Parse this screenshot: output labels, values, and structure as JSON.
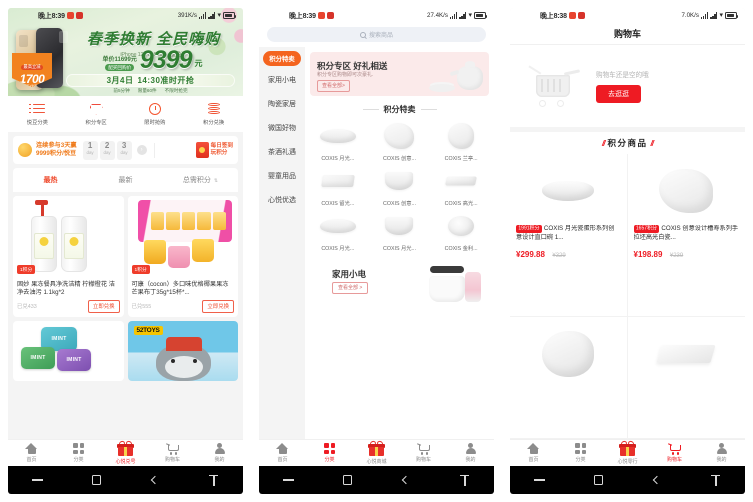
{
  "phone1": {
    "status": {
      "time": "晚上8:39",
      "speed": "391K/s",
      "icons": [
        "signal",
        "signal",
        "wifi",
        "battery"
      ]
    },
    "banner": {
      "title": "春季换新 全民嗨购",
      "subtitle": "iPhone 12 Pro 5199（金色）",
      "old_price_label": "单价11699元",
      "old_price_tag": "配买回购价",
      "price": "9399",
      "price_unit": "元",
      "date": "3月4日",
      "time": "14:30准时开抢",
      "sub1": "前5分钟",
      "sub2": "限量60件",
      "sub3": "不限时抢完",
      "flag_top": "最高立减",
      "flag_num": "1700",
      "flag_bottom": "元优惠"
    },
    "quicknav": [
      {
        "icon": "list-icon",
        "label": "悦豆分类"
      },
      {
        "icon": "diamond-icon",
        "label": "积分专区"
      },
      {
        "icon": "clock-icon",
        "label": "限时抢购"
      },
      {
        "icon": "coins-icon",
        "label": "积分兑换"
      }
    ],
    "signin": {
      "line1": "连续参与3天赢",
      "line2": "9999积分/悦豆",
      "days": [
        {
          "n": "1",
          "unit": "day"
        },
        {
          "n": "2",
          "unit": "day"
        },
        {
          "n": "3",
          "unit": "day"
        }
      ],
      "arrow": "›",
      "gift_line1": "每日签到",
      "gift_line2": "玩积分"
    },
    "sorttabs": [
      {
        "label": "最热",
        "active": true
      },
      {
        "label": "最新",
        "active": false
      },
      {
        "label": "总需积分",
        "active": false,
        "caret": "⇅"
      }
    ],
    "products": [
      {
        "badge": "1积分",
        "title": "固妙 果冻餐具净洗洁精 柠檬橙花 洁净去油污 1.1kg*2",
        "exchanged": "已兑433",
        "button": "立即兑换"
      },
      {
        "badge": "1积分",
        "title": "可康（cocon）多口味优格椰果果冻 芒果布丁35g*15杯*...",
        "exchanged": "已兑555",
        "button": "立即兑换"
      }
    ],
    "promos": [
      {
        "name": "mint-tins-promo",
        "label": "IMINT"
      },
      {
        "name": "52toys-promo",
        "label": "52TOYS"
      }
    ],
    "tabbar": [
      {
        "icon": "home-icon",
        "label": "首页",
        "active": false
      },
      {
        "icon": "grid-icon",
        "label": "分类",
        "active": false
      },
      {
        "icon": "gift-icon",
        "label": "心悦兑号",
        "active": true
      },
      {
        "icon": "cart-icon",
        "label": "购物车",
        "active": false
      },
      {
        "icon": "user-icon",
        "label": "我的",
        "active": false
      }
    ]
  },
  "phone2": {
    "status": {
      "time": "晚上8:39",
      "speed": "27.4K/s"
    },
    "search": {
      "placeholder": "搜索商品",
      "icon": "search-icon"
    },
    "categories": [
      {
        "label": "积分特卖",
        "active": true
      },
      {
        "label": "家用小电",
        "active": false
      },
      {
        "label": "陶瓷家居",
        "active": false
      },
      {
        "label": "微国好物",
        "active": false
      },
      {
        "label": "茶酒礼遇",
        "active": false
      },
      {
        "label": "婴童用品",
        "active": false
      },
      {
        "label": "心悦优选",
        "active": false
      }
    ],
    "banner": {
      "title": "积分专区 好礼相送",
      "subtitle": "积分专区购物即可次豪礼.",
      "button": "查看全部>"
    },
    "section_title": "积分特卖",
    "grid": [
      {
        "name": "COXIS 月光..."
      },
      {
        "name": "COXIS 创意..."
      },
      {
        "name": "COXIS 兰亭..."
      },
      {
        "name": "COXIS 留光..."
      },
      {
        "name": "COXIS 创意..."
      },
      {
        "name": "COXIS 高光..."
      },
      {
        "name": "COXIS 月光..."
      },
      {
        "name": "COXIS 月光..."
      },
      {
        "name": "COXIS 金利..."
      }
    ],
    "footer_card": {
      "title": "家用小电",
      "button": "查看全部 >"
    },
    "tabbar": [
      {
        "icon": "home-icon",
        "label": "首页",
        "active": false
      },
      {
        "icon": "grid-icon",
        "label": "分类",
        "active": true
      },
      {
        "icon": "gift-icon",
        "label": "心悦商城",
        "active": false
      },
      {
        "icon": "cart-icon",
        "label": "购物车",
        "active": false
      },
      {
        "icon": "user-icon",
        "label": "我的",
        "active": false
      }
    ]
  },
  "phone3": {
    "status": {
      "time": "晚上8:38",
      "speed": "7.0K/s"
    },
    "header_title": "购物车",
    "empty": {
      "message": "购物车还是空的哦",
      "button": "去逛逛",
      "icon": "empty-cart-icon"
    },
    "section_title": "积分商品",
    "section_slash": "//",
    "products": [
      {
        "badge": "1991积分",
        "title": "COXIS 月光瓷蛋形系列创意设计直口碗 1...",
        "price": "¥299.88",
        "old_price": "¥329"
      },
      {
        "badge": "1657积分",
        "title": "COXIS 创意设计槽寿系列手拉坯高光白瓷...",
        "price": "¥198.89",
        "old_price": "¥239"
      },
      {
        "badge": "",
        "title": "",
        "price": "",
        "old_price": ""
      },
      {
        "badge": "",
        "title": "",
        "price": "",
        "old_price": ""
      }
    ],
    "tabbar": [
      {
        "icon": "home-icon",
        "label": "首页",
        "active": false
      },
      {
        "icon": "grid-icon",
        "label": "分类",
        "active": false
      },
      {
        "icon": "gift-icon",
        "label": "心悦零行",
        "active": false
      },
      {
        "icon": "cart-icon",
        "label": "购物车",
        "active": true
      },
      {
        "icon": "user-icon",
        "label": "我的",
        "active": false
      }
    ]
  },
  "navbar": {
    "recent": "recent-apps-icon",
    "home": "home-nav-icon",
    "back": "back-icon",
    "extra": "keyboard-icon"
  },
  "colors": {
    "brand_red": "#ee1b23",
    "orange": "#f4641f",
    "green": "#2f7d32",
    "gray": "#8c8c8c"
  }
}
